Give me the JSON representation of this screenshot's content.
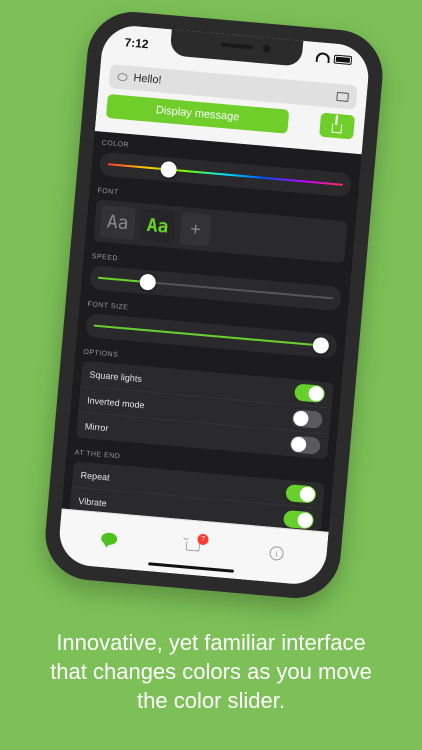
{
  "status": {
    "time": "7:12"
  },
  "message": {
    "value": "Hello!"
  },
  "actions": {
    "display_label": "Display message"
  },
  "sections": {
    "color": "COLOR",
    "font": "FONT",
    "speed": "SPEED",
    "font_size": "FONT SIZE",
    "options": "OPTIONS",
    "at_the_end": "AT THE END"
  },
  "sliders": {
    "color": 0.24,
    "speed": 0.19,
    "font_size": 1.0
  },
  "fonts": [
    {
      "label": "Aa"
    },
    {
      "label": "Aa",
      "selected": true
    }
  ],
  "fonts_add": "+",
  "options": [
    {
      "label": "Square lights",
      "on": true
    },
    {
      "label": "Inverted mode",
      "on": false
    },
    {
      "label": "Mirror",
      "on": false
    }
  ],
  "at_the_end": [
    {
      "label": "Repeat",
      "on": true
    },
    {
      "label": "Vibrate",
      "on": true
    }
  ],
  "tabbar": {
    "cart_badge": "7",
    "info_glyph": "i"
  },
  "caption": {
    "line1": "Innovative, yet familiar interface",
    "line2": "that changes colors as you move",
    "line3": "the color slider."
  },
  "colors": {
    "background": "#7cc057",
    "accent": "#67d02c",
    "panel": "#1c1c1e"
  },
  "icons": [
    "chat-bubble-icon",
    "folder-icon",
    "share-icon",
    "chat-icon",
    "cart-icon",
    "info-icon"
  ]
}
